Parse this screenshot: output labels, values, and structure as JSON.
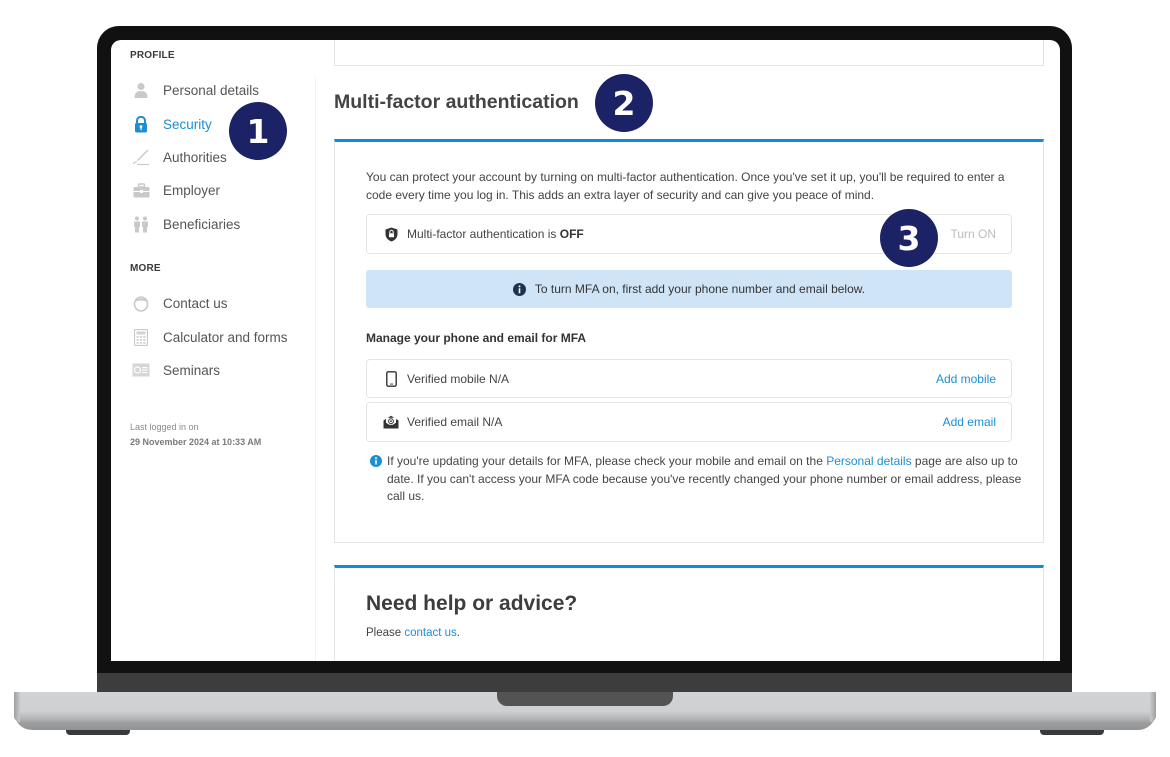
{
  "sidebar": {
    "profile_heading": "PROFILE",
    "profile_items": [
      {
        "label": "Personal details",
        "icon": "person-icon",
        "active": false
      },
      {
        "label": "Security",
        "icon": "lock-icon",
        "active": true
      },
      {
        "label": "Authorities",
        "icon": "pen-icon",
        "active": false
      },
      {
        "label": "Employer",
        "icon": "briefcase-icon",
        "active": false
      },
      {
        "label": "Beneficiaries",
        "icon": "beneficiaries-icon",
        "active": false
      }
    ],
    "more_heading": "MORE",
    "more_items": [
      {
        "label": "Contact us",
        "icon": "contact-icon"
      },
      {
        "label": "Calculator and forms",
        "icon": "calculator-icon"
      },
      {
        "label": "Seminars",
        "icon": "seminars-icon"
      }
    ],
    "last_login_label": "Last logged in on",
    "last_login_value": "29 November 2024 at 10:33 AM"
  },
  "mfa": {
    "title": "Multi-factor authentication",
    "description": "You can protect your account by turning on multi-factor authentication. Once you've set it up, you'll be required to enter a code every time you log in. This adds an extra layer of security and can give you peace of mind.",
    "status_prefix": "Multi-factor authentication is ",
    "status_value": "OFF",
    "turn_on_label": "Turn ON",
    "banner_text": "To turn MFA on, first add your phone number and email below.",
    "manage_heading": "Manage your phone and email for MFA",
    "contacts": [
      {
        "label": "Verified mobile N/A",
        "action": "Add mobile",
        "icon": "mobile-phone-icon"
      },
      {
        "label": "Verified email N/A",
        "action": "Add email",
        "icon": "email-icon"
      }
    ],
    "note": {
      "before": "If you're updating your details for MFA, please check your mobile and email on the ",
      "link": "Personal details",
      "after": " page are also up to date. If you can't access your MFA code because you've recently changed your phone number or email address, please call us."
    }
  },
  "help": {
    "title": "Need help or advice?",
    "prefix": "Please ",
    "link": "contact us",
    "suffix": "."
  },
  "callouts": [
    "1",
    "2",
    "3"
  ],
  "colors": {
    "accent_blue": "#1a8fd6",
    "card_border_blue": "#0b8ed9",
    "banner_bg": "#cfe5f7",
    "callout_badge": "#1b2266",
    "disabled_text": "#bcbcbc"
  }
}
